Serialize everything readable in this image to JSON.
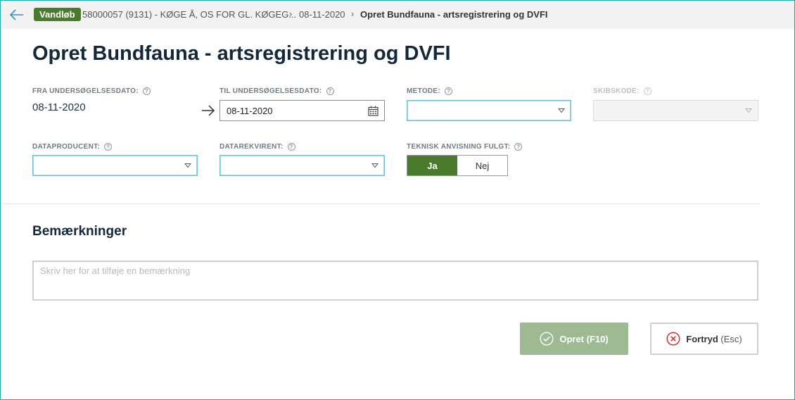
{
  "breadcrumb": {
    "badge": "Vandløb",
    "location": "58000057 (9131) - KØGE Å, OS FOR GL. KØGEG...",
    "date": "08-11-2020",
    "current": "Opret Bundfauna - artsregistrering og DVFI",
    "separator": "›"
  },
  "page": {
    "title": "Opret Bundfauna - artsregistrering og DVFI"
  },
  "fields": {
    "fra_dato": {
      "label": "FRA UNDERSØGELSESDATO:",
      "value": "08-11-2020"
    },
    "til_dato": {
      "label": "TIL UNDERSØGELSESDATO:",
      "value": "08-11-2020"
    },
    "metode": {
      "label": "METODE:",
      "value": ""
    },
    "skibskode": {
      "label": "SKIBSKODE:",
      "value": ""
    },
    "dataproducent": {
      "label": "DATAPRODUCENT:",
      "value": ""
    },
    "datarekvirent": {
      "label": "DATAREKVIRENT:",
      "value": ""
    },
    "teknisk": {
      "label": "TEKNISK ANVISNING FULGT:",
      "options": [
        "Ja",
        "Nej"
      ],
      "selected": "Ja"
    }
  },
  "help_glyph": "?",
  "remarks": {
    "title": "Bemærkninger",
    "placeholder": "Skriv her for at tilføje en bemærkning"
  },
  "actions": {
    "create_label": "Opret (F10)",
    "cancel_label": "Fortryd",
    "cancel_key": "(Esc)"
  },
  "colors": {
    "accent_green": "#4a7a2c",
    "primary_button": "#9dba93",
    "focus_border": "#6fc3d6",
    "cancel_icon": "#d9262c"
  },
  "icons": {
    "back": "arrow-left-icon",
    "arrow": "arrow-right-icon",
    "calendar": "calendar-icon",
    "caret": "caret-down-icon",
    "check": "check-circle-icon",
    "cancel": "x-circle-icon"
  }
}
